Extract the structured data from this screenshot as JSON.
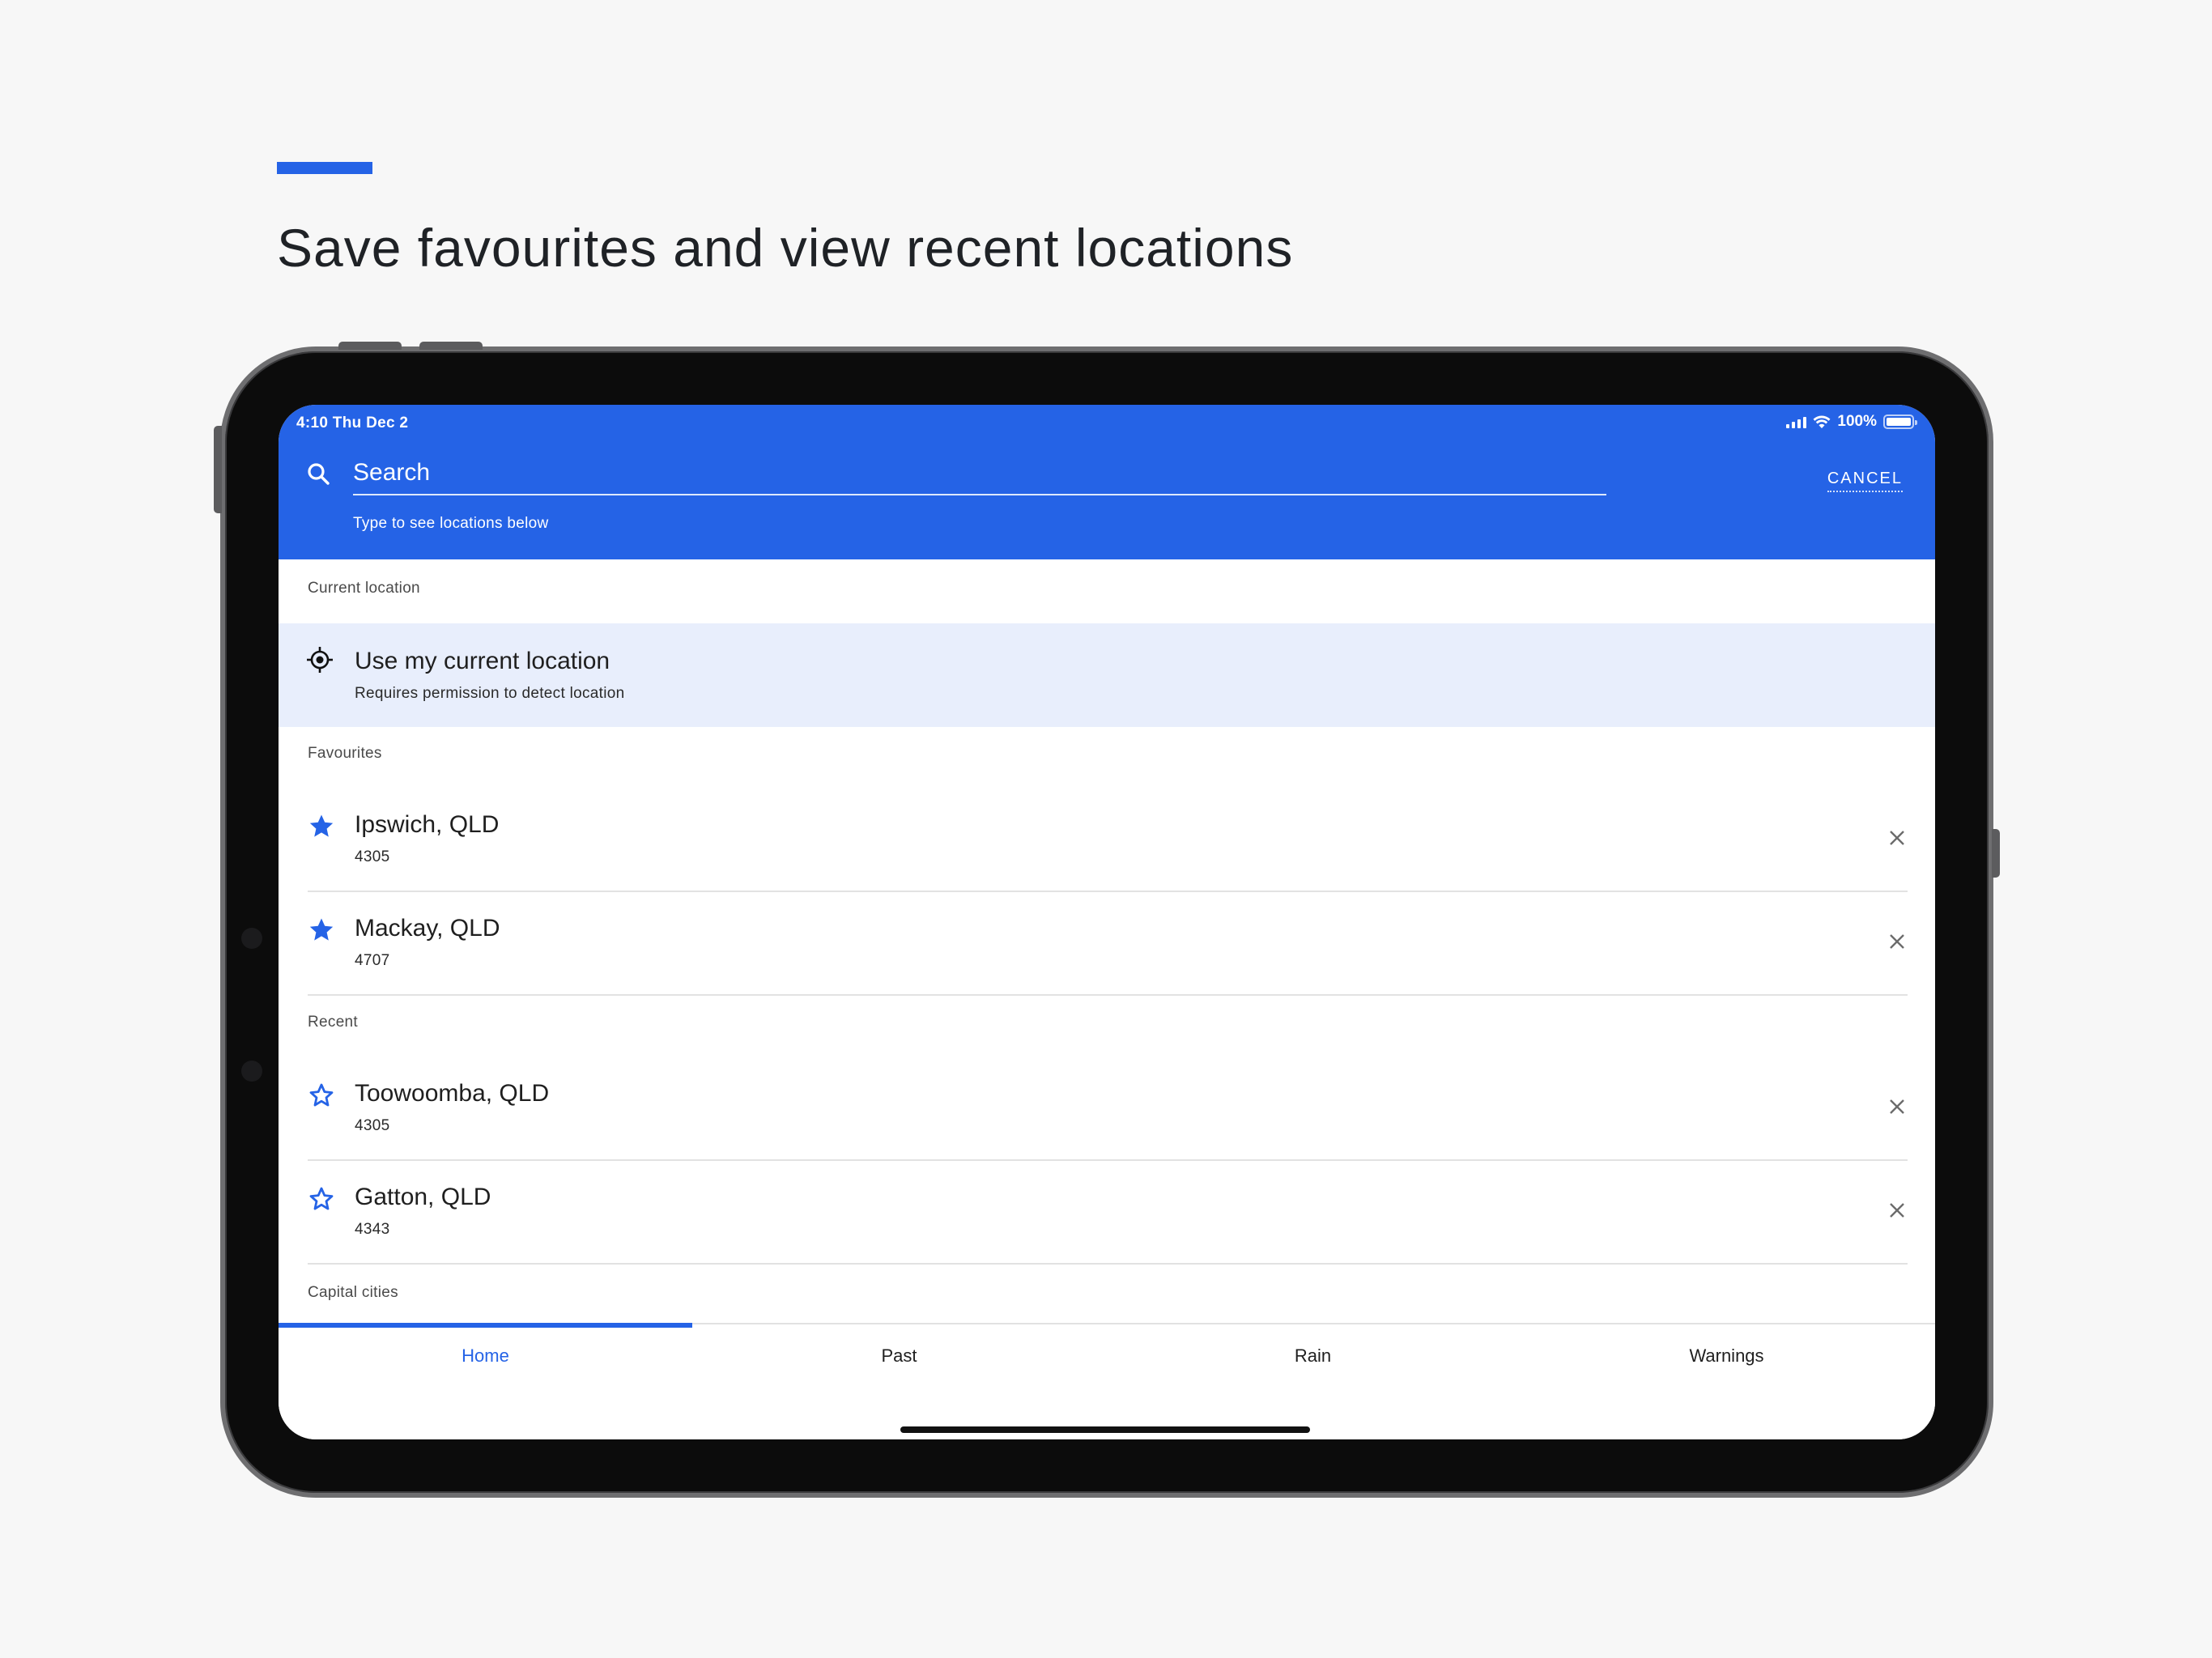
{
  "page": {
    "heading": "Save favourites and view recent locations",
    "accent_color": "#2563e6"
  },
  "status_bar": {
    "time": "4:10  Thu Dec 2",
    "battery": "100%"
  },
  "search": {
    "placeholder": "Search",
    "hint": "Type to see locations below",
    "cancel_label": "CANCEL"
  },
  "sections": {
    "current_label": "Current location",
    "favourites_label": "Favourites",
    "recent_label": "Recent",
    "capitals_label": "Capital cities"
  },
  "current_location": {
    "title": "Use my current location",
    "subtitle": "Requires permission to detect location"
  },
  "favourites": [
    {
      "name": "Ipswich, QLD",
      "postcode": "4305"
    },
    {
      "name": "Mackay, QLD",
      "postcode": "4707"
    }
  ],
  "recent": [
    {
      "name": "Toowoomba, QLD",
      "postcode": "4305"
    },
    {
      "name": "Gatton, QLD",
      "postcode": "4343"
    }
  ],
  "nav": {
    "tabs": [
      {
        "label": "Home",
        "active": true
      },
      {
        "label": "Past",
        "active": false
      },
      {
        "label": "Rain",
        "active": false
      },
      {
        "label": "Warnings",
        "active": false
      }
    ]
  },
  "icons": {
    "search": "search-icon",
    "location": "crosshair-icon",
    "favourite": "star-filled-icon",
    "recent": "star-outline-icon",
    "remove": "close-icon"
  }
}
